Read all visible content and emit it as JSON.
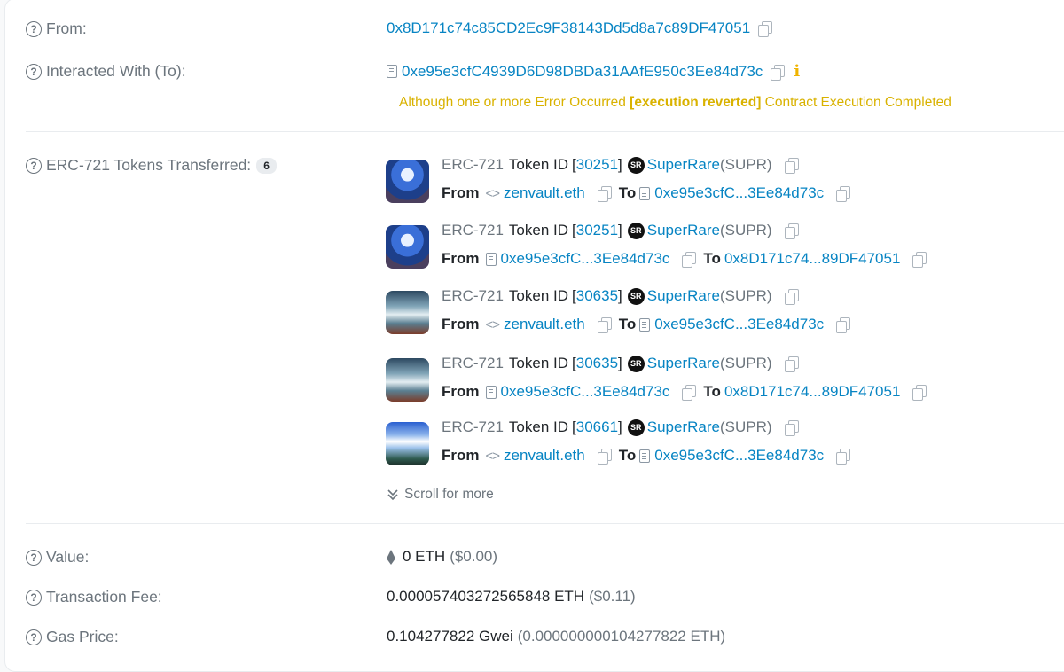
{
  "from": {
    "label": "From:",
    "address": "0x8D171c74c85CD2Ec9F38143Dd5d8a7c89DF47051"
  },
  "interacted": {
    "label": "Interacted With (To):",
    "address": "0xe95e3cfC4939D6D98DBDa31AAfE950c3Ee84d73c",
    "info_glyph": "i",
    "warning_prefix": "Although one or more Error Occurred ",
    "warning_bracket_open": "[",
    "warning_reason": "execution reverted",
    "warning_bracket_close": "]",
    "warning_suffix": " Contract Execution Completed"
  },
  "erc721": {
    "label": "ERC-721 Tokens Transferred:",
    "count": "6",
    "transfers": [
      {
        "standard": "ERC-721",
        "token_id_label": "Token ID",
        "token_id": "30251",
        "collection": "SuperRare",
        "symbol": "(SUPR)",
        "logo_text": "SR",
        "from_label": "From",
        "from": "zenvault.eth",
        "from_type": "code",
        "to_label": "To",
        "to": "0xe95e3cfC...3Ee84d73c",
        "to_type": "doc"
      },
      {
        "standard": "ERC-721",
        "token_id_label": "Token ID",
        "token_id": "30251",
        "collection": "SuperRare",
        "symbol": "(SUPR)",
        "logo_text": "SR",
        "from_label": "From",
        "from": "0xe95e3cfC...3Ee84d73c",
        "from_type": "doc",
        "to_label": "To",
        "to": "0x8D171c74...89DF47051",
        "to_type": "none"
      },
      {
        "standard": "ERC-721",
        "token_id_label": "Token ID",
        "token_id": "30635",
        "collection": "SuperRare",
        "symbol": "(SUPR)",
        "logo_text": "SR",
        "from_label": "From",
        "from": "zenvault.eth",
        "from_type": "code",
        "to_label": "To",
        "to": "0xe95e3cfC...3Ee84d73c",
        "to_type": "doc"
      },
      {
        "standard": "ERC-721",
        "token_id_label": "Token ID",
        "token_id": "30635",
        "collection": "SuperRare",
        "symbol": "(SUPR)",
        "logo_text": "SR",
        "from_label": "From",
        "from": "0xe95e3cfC...3Ee84d73c",
        "from_type": "doc",
        "to_label": "To",
        "to": "0x8D171c74...89DF47051",
        "to_type": "none"
      },
      {
        "standard": "ERC-721",
        "token_id_label": "Token ID",
        "token_id": "30661",
        "collection": "SuperRare",
        "symbol": "(SUPR)",
        "logo_text": "SR",
        "from_label": "From",
        "from": "zenvault.eth",
        "from_type": "code",
        "to_label": "To",
        "to": "0xe95e3cfC...3Ee84d73c",
        "to_type": "doc"
      }
    ],
    "scroll_label": "Scroll for more"
  },
  "value": {
    "label": "Value:",
    "amount": "0 ETH",
    "usd": "($0.00)"
  },
  "fee": {
    "label": "Transaction Fee:",
    "amount": "0.000057403272565848 ETH",
    "usd": "($0.11)"
  },
  "gas": {
    "label": "Gas Price:",
    "amount": "0.104277822 Gwei",
    "eth": "(0.000000000104277822 ETH)"
  },
  "colors": {
    "link": "#0784c3",
    "warning": "#d9b200",
    "muted": "#6c757d"
  },
  "icons": {
    "question": "?",
    "code": "<>",
    "scroll": "double-chevron-down-icon"
  }
}
